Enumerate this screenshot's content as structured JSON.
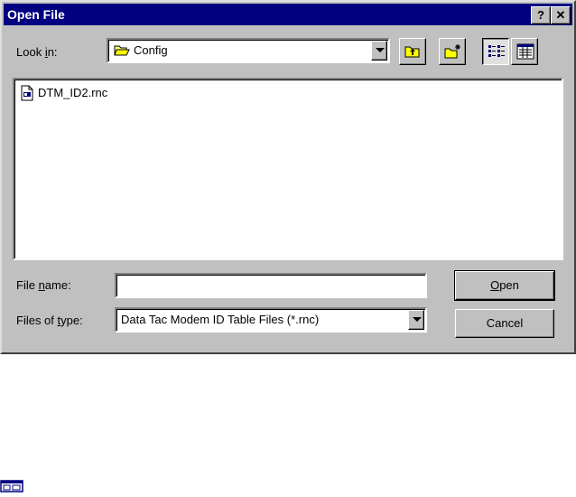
{
  "window": {
    "title": "Open File",
    "help_label": "?",
    "close_label": "✕"
  },
  "look_in": {
    "label_pre": "Look ",
    "label_accel": "i",
    "label_post": "n:",
    "value": "Config"
  },
  "toolbar": {
    "up_folder_icon": "up-folder-icon",
    "new_folder_icon": "new-folder-icon",
    "list_view_icon": "list-view-icon",
    "details_view_icon": "details-view-icon"
  },
  "files": [
    {
      "name": "DTM_ID2.rnc",
      "icon": "document-icon"
    }
  ],
  "file_name": {
    "label_pre": "File ",
    "label_accel": "n",
    "label_post": "ame:",
    "value": ""
  },
  "file_type": {
    "label_pre": "Files of ",
    "label_accel": "t",
    "label_post": "ype:",
    "value": "Data Tac Modem ID Table Files (*.rnc)"
  },
  "buttons": {
    "open_accel": "O",
    "open_rest": "pen",
    "cancel": "Cancel"
  },
  "colors": {
    "face": "#c0c0c0",
    "title_bar": "#000080",
    "shadow": "#808080",
    "highlight": "#ffffff"
  }
}
